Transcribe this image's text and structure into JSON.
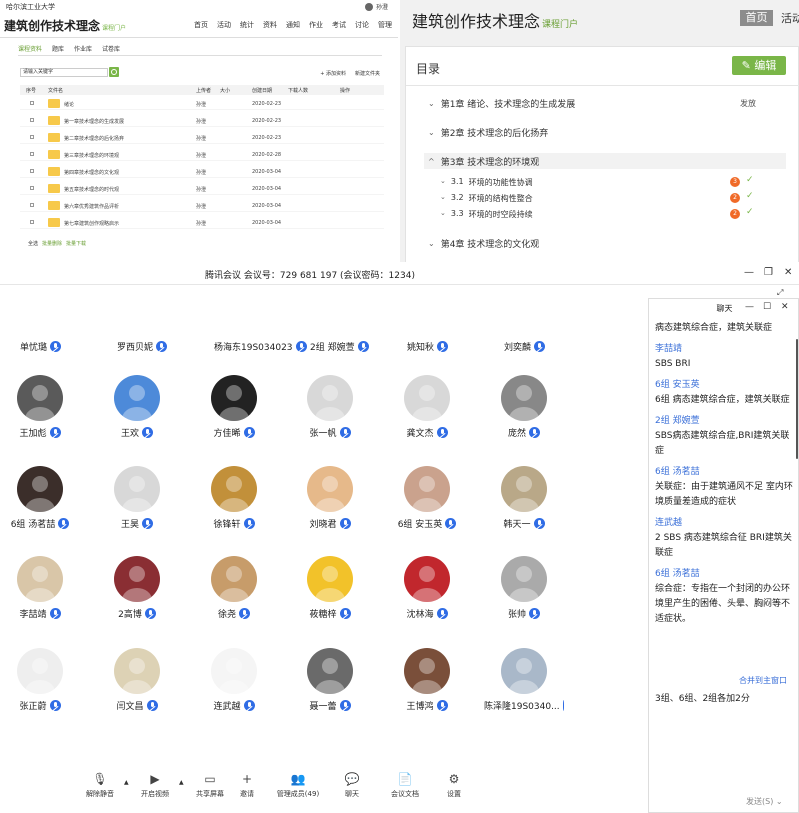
{
  "portal_left": {
    "university": "哈尔滨工业大学",
    "user": "孙澄",
    "course_title": "建筑创作技术理念",
    "course_sub": "课程门户",
    "nav": [
      "首页",
      "活动",
      "统计",
      "资料",
      "通知",
      "作业",
      "考试",
      "讨论",
      "管理"
    ],
    "tabs": [
      "课程资料",
      "题库",
      "作业库",
      "试卷库"
    ],
    "search_placeholder": "请输入关键字",
    "tools": [
      "+ 添加资料",
      "新建文件夹"
    ],
    "headers": [
      "序号",
      "文件名",
      "上传者",
      "大小",
      "创建日期",
      "下载人数",
      "操作"
    ],
    "rows": [
      {
        "name": "绪论",
        "uploader": "孙澄",
        "date": "2020-02-23"
      },
      {
        "name": "第一章技术理念的生成发展",
        "uploader": "孙澄",
        "date": "2020-02-23"
      },
      {
        "name": "第二章技术理念的后化扬弃",
        "uploader": "孙澄",
        "date": "2020-02-23"
      },
      {
        "name": "第三章技术理念的环境观",
        "uploader": "孙澄",
        "date": "2020-02-28"
      },
      {
        "name": "第四章技术理念的文化观",
        "uploader": "孙澄",
        "date": "2020-03-04"
      },
      {
        "name": "第五章技术理念的时代观",
        "uploader": "孙澄",
        "date": "2020-03-04"
      },
      {
        "name": "第六章优秀建筑作品评析",
        "uploader": "孙澄",
        "date": "2020-03-04"
      },
      {
        "name": "第七章建筑创作观略启示",
        "uploader": "孙澄",
        "date": "2020-03-04"
      }
    ],
    "footer": {
      "select_all": "全选",
      "batch_delete": "批量删除",
      "batch_download": "批量下载"
    }
  },
  "portal_right": {
    "title": "建筑创作技术理念",
    "title_sub": "课程门户",
    "home": "首页",
    "activity": "活动",
    "catalog": "目录",
    "edit": "✎ 编辑",
    "publish": "发放",
    "chapters": [
      {
        "label": "第1章 绪论、技术理念的生成发展"
      },
      {
        "label": "第2章 技术理念的后化扬弃"
      },
      {
        "label": "第3章 技术理念的环境观"
      },
      {
        "label": "第4章 技术理念的文化观"
      }
    ],
    "sections": [
      {
        "num": "3.1",
        "label": "环境的功能性协调",
        "badge": "3"
      },
      {
        "num": "3.2",
        "label": "环境的结构性整合",
        "badge": "2"
      },
      {
        "num": "3.3",
        "label": "环境的时空段持续",
        "badge": "2"
      }
    ]
  },
  "meeting": {
    "title": "腾讯会议  会议号：729 681 197  (会议密码：1234)",
    "top_names": [
      "单忧璐",
      "罗西贝妮",
      "杨海东19S034023",
      "2组 郑婉萱",
      "姚知秋",
      "刘奕麟"
    ],
    "participants": [
      [
        "王加彪",
        "王欢",
        "方佳晞",
        "张一帆",
        "龚文杰",
        "庞然"
      ],
      [
        "6组 汤茗喆",
        "王昊",
        "徐锋轩",
        "刘晓君",
        "6组 安玉英",
        "韩天一"
      ],
      [
        "李喆靖",
        "2高博",
        "徐尧",
        "莜糖梓",
        "沈林海",
        "张帅"
      ],
      [
        "张正蔚",
        "闫文昌",
        "连武越",
        "聂一蕾",
        "王博鸿",
        "陈泽隆19S0340..."
      ]
    ],
    "toolbar": [
      "解除静音",
      "开启视频",
      "共享屏幕",
      "邀请",
      "管理成员(49)",
      "聊天",
      "会议文档",
      "设置"
    ]
  },
  "chat": {
    "title": "聊天",
    "messages": [
      {
        "text": "病态建筑综合症，建筑关联症"
      },
      {
        "user": "李喆靖",
        "text": "SBS  BRI"
      },
      {
        "user": "6组 安玉英",
        "text": "6组  病态建筑综合症，建筑关联症"
      },
      {
        "user": "2组 郑婉萱",
        "text": "SBS病态建筑综合症,BRI建筑关联症"
      },
      {
        "user": "6组 汤茗喆",
        "text": "关联症：由于建筑通风不足 室内环境质量差造成的症状"
      },
      {
        "user": "连武越",
        "text": "2 SBS  病态建筑综合征 BRI建筑关联症"
      },
      {
        "user": "6组 汤茗喆",
        "text": "综合症：专指在一个封闭的办公环境里产生的困倦、头晕、胸闷等不适症状。"
      }
    ],
    "merge": "合并到主窗口",
    "input_text": "3组、6组、2组各加2分",
    "send": "发送(S)"
  },
  "colors": {
    "accent_green": "#7ab648",
    "mic_blue": "#2f6ce5",
    "badge_orange": "#f06a28",
    "chat_user_blue": "#3a6fd8"
  }
}
